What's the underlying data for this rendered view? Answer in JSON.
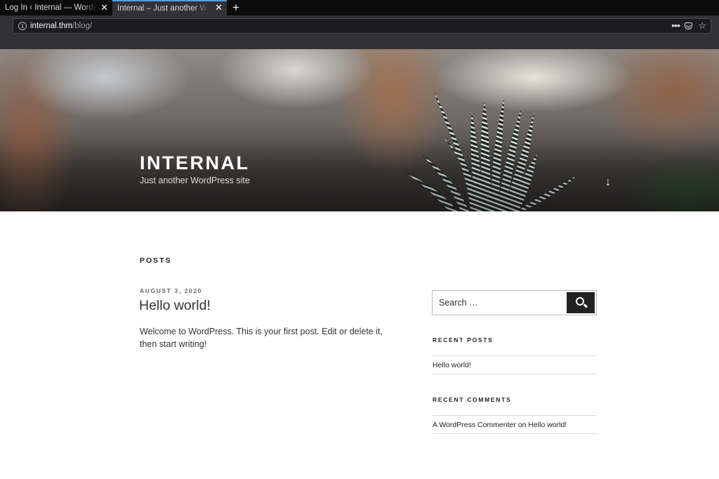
{
  "browser": {
    "tabs": [
      {
        "title": "Log In ‹ Internal — WordPress",
        "close": "✕"
      },
      {
        "title": "Internal – Just another WordPress site",
        "close": "✕"
      }
    ],
    "new_tab": "+",
    "url": {
      "host": "internal.thm",
      "path": "/blog/"
    },
    "icons": [
      "info-icon",
      "more-icon",
      "pocket-icon",
      "star-icon"
    ],
    "active_tab_accent": "#45a1ff"
  },
  "header": {
    "site_title": "INTERNAL",
    "site_description": "Just another WordPress site",
    "scroll_icon": "↓"
  },
  "main": {
    "section_heading": "POSTS",
    "post": {
      "date": "AUGUST 3, 2020",
      "title": "Hello world!",
      "excerpt": "Welcome to WordPress. This is your first post. Edit or delete it, then start writing!"
    }
  },
  "sidebar": {
    "search": {
      "placeholder": "Search …"
    },
    "recent_posts": {
      "title": "RECENT POSTS",
      "items": [
        "Hello world!"
      ]
    },
    "recent_comments": {
      "title": "RECENT COMMENTS",
      "items": [
        {
          "author": "A WordPress Commenter",
          "on": "on",
          "post": "Hello world!"
        }
      ]
    }
  }
}
